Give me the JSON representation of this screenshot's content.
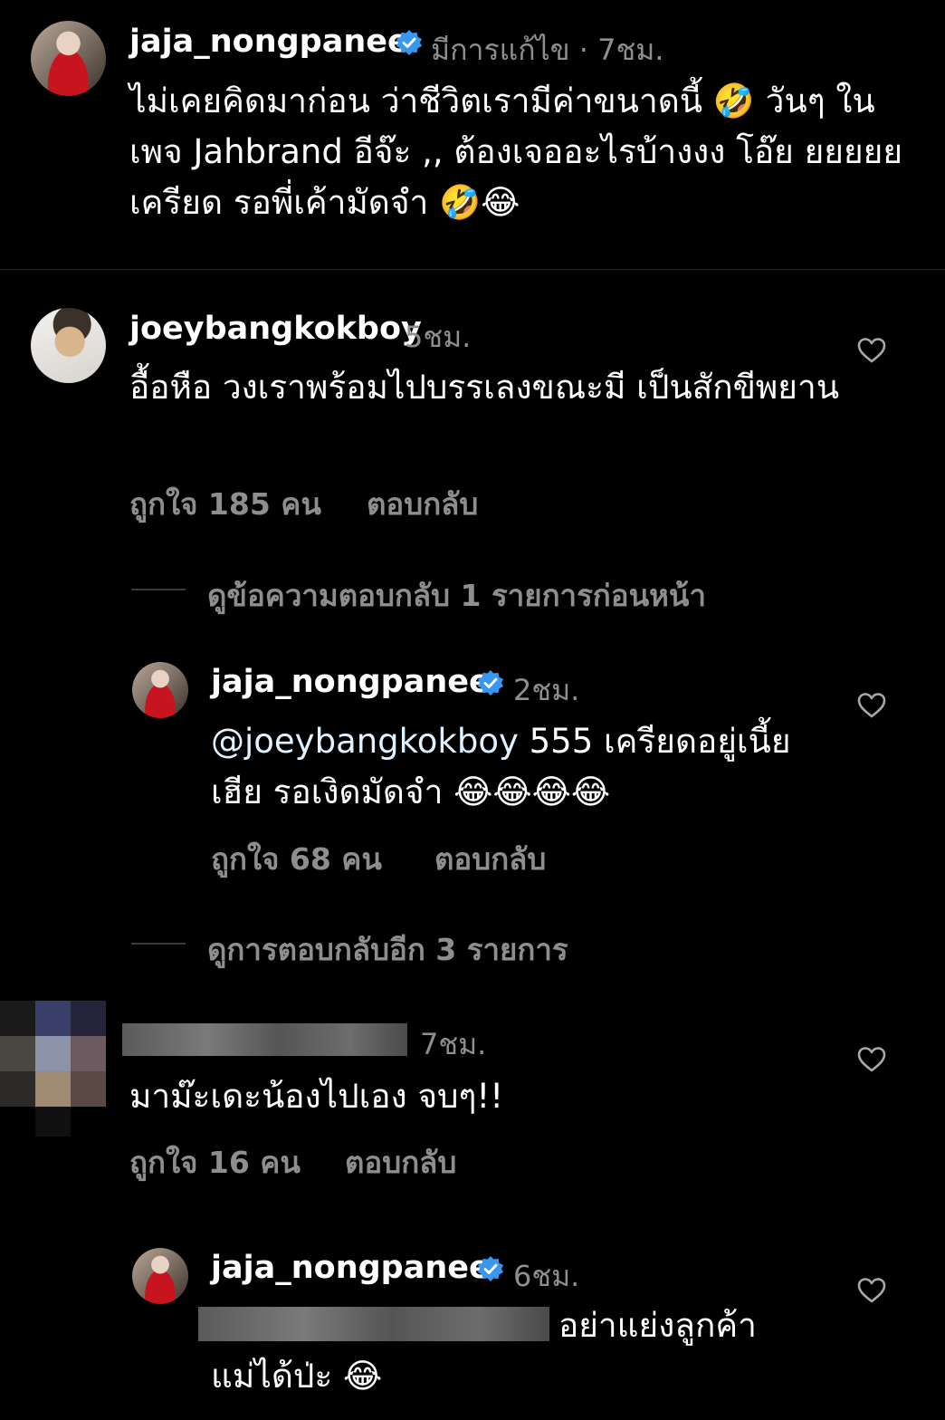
{
  "post": {
    "username": "jaja_nongpanee",
    "edited": "มีการแก้ไข",
    "separator": "·",
    "time": "7ชม.",
    "text": "ไม่เคยคิดมาก่อน ว่าชีวิตเรามีค่าขนาดนี้ 🤣 วันๆ ในเพจ Jahbrand อีจ๊ะ ,, ต้องเจออะไรบ้างงง โอ๊ย ยยยยย เครียด รอพี่เค้ามัดจำ 🤣😂"
  },
  "comment1": {
    "username": "joeybangkokboy",
    "time": "5ชม.",
    "text": "อื้อหือ วงเราพร้อมไปบรรเลงขณะมี เป็นสักขีพยาน",
    "likes": "ถูกใจ 185 คน",
    "reply": "ตอบกลับ",
    "view_prev": "ดูข้อความตอบกลับ 1 รายการก่อนหน้า"
  },
  "reply1": {
    "username": "jaja_nongpanee",
    "time": "2ชม.",
    "mention": "@joeybangkokboy",
    "text": " 555 เครียดอยู่เนี้ยเฮีย รอเงิดมัดจำ 😂😂😂😂",
    "likes": "ถูกใจ 68 คน",
    "reply": "ตอบกลับ",
    "view_more": "ดูการตอบกลับอีก 3 รายการ"
  },
  "comment2": {
    "username_hidden": "",
    "time": "7ชม.",
    "text": "มาม๊ะเดะน้องไปเอง จบๆ!!",
    "likes": "ถูกใจ 16 คน",
    "reply": "ตอบกลับ"
  },
  "reply2": {
    "username": "jaja_nongpanee",
    "time": "6ชม.",
    "text": "อย่าแย่งลูกค้า",
    "text2": "แม่ได้ป่ะ 😂"
  },
  "colors": {
    "background": "#000000",
    "muted": "#8e8e8e",
    "verified": "#3897f0",
    "heart_outline": "#a8a8a8"
  },
  "icons": [
    "verified-badge-icon",
    "heart-icon"
  ]
}
